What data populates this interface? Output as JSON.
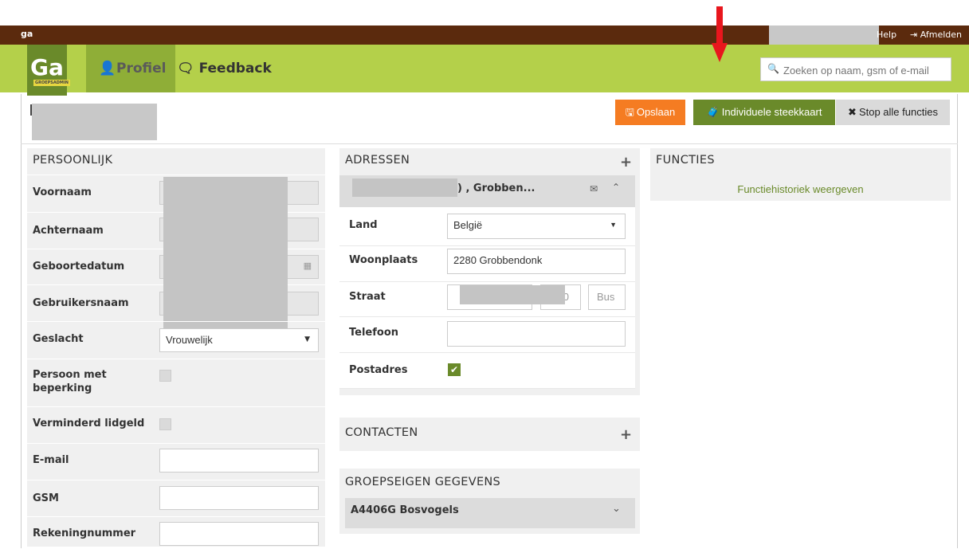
{
  "topbar": {
    "help": "Help",
    "logout": "Afmelden",
    "mini_logo": "ga"
  },
  "nav": {
    "brand": "Ga",
    "brand_sub": "GROEPSADMIN",
    "profiel": "Profiel",
    "feedback": "Feedback"
  },
  "search": {
    "placeholder": "Zoeken op naam, gsm of e-mail"
  },
  "actions": {
    "save": "Opslaan",
    "card": "Individuele steekkaart",
    "stop": "Stop alle functies"
  },
  "persoonlijk": {
    "title": "PERSOONLIJK",
    "voornaam": "Voornaam",
    "achternaam": "Achternaam",
    "geboortedatum": "Geboortedatum",
    "gebruikersnaam": "Gebruikersnaam",
    "geslacht": "Geslacht",
    "geslacht_value": "Vrouwelijk",
    "beperking": "Persoon met beperking",
    "lidgeld": "Verminderd lidgeld",
    "email": "E-mail",
    "gsm": "GSM",
    "rekening": "Rekeningnummer"
  },
  "adressen": {
    "title": "ADRESSEN",
    "head_text": ") , Grobben...",
    "land": "Land",
    "land_value": "België",
    "woonplaats": "Woonplaats",
    "woonplaats_value": "2280 Grobbendonk",
    "straat": "Straat",
    "nr_partial": "0",
    "bus_placeholder": "Bus",
    "telefoon": "Telefoon",
    "postadres": "Postadres"
  },
  "contacten": {
    "title": "CONTACTEN"
  },
  "groep": {
    "title": "GROEPSEIGEN GEGEVENS",
    "row": "A4406G Bosvogels"
  },
  "functies": {
    "title": "FUNCTIES",
    "link": "Functiehistoriek weergeven"
  },
  "colors": {
    "topbar": "#5b2a0d",
    "navbar": "#b4d04a",
    "green": "#6a8a2a",
    "orange": "#f57c22",
    "arrow": "#e8161d"
  }
}
